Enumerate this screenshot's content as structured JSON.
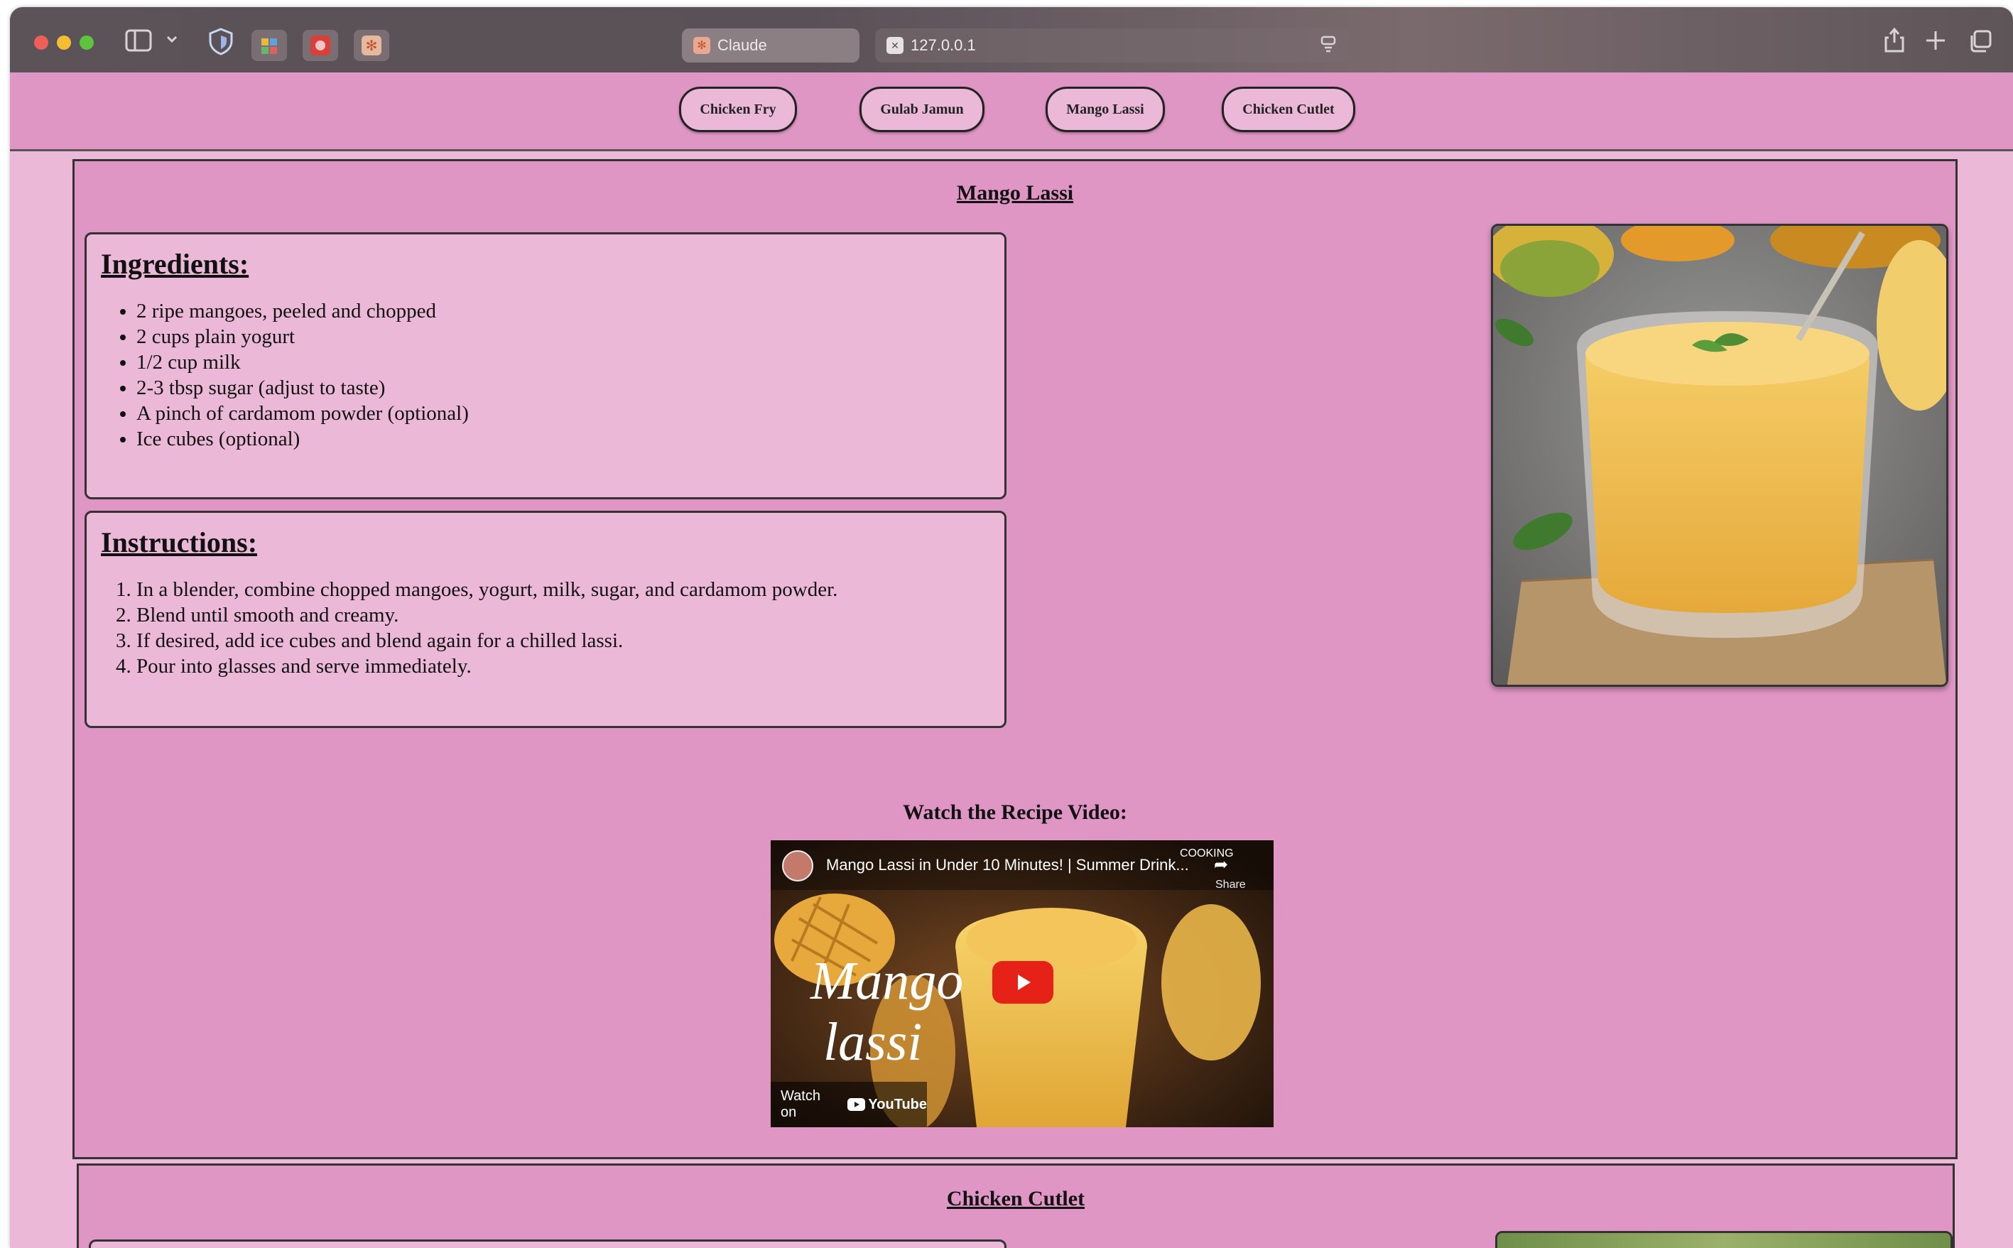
{
  "browser": {
    "tabs": [
      {
        "label": "Claude",
        "active": true
      },
      {
        "label": "127.0.0.1",
        "active": false
      }
    ],
    "icons": [
      "sidebar-icon",
      "chevron-down-icon",
      "shield-icon",
      "share-icon",
      "plus-icon",
      "tabs-overview-icon"
    ]
  },
  "nav": {
    "buttons": [
      "Chicken Fry",
      "Gulab Jamun",
      "Mango Lassi",
      "Chicken Cutlet"
    ]
  },
  "recipe": {
    "title": "Mango Lassi",
    "ingredients_heading": "Ingredients:",
    "ingredients": [
      "2 ripe mangoes, peeled and chopped",
      "2 cups plain yogurt",
      "1/2 cup milk",
      "2-3 tbsp sugar (adjust to taste)",
      "A pinch of cardamom powder (optional)",
      "Ice cubes (optional)"
    ],
    "instructions_heading": "Instructions:",
    "instructions": [
      "In a blender, combine chopped mangoes, yogurt, milk, sugar, and cardamom powder.",
      "Blend until smooth and creamy.",
      "If desired, add ice cubes and blend again for a chilled lassi.",
      "Pour into glasses and serve immediately."
    ],
    "video_heading": "Watch the Recipe Video:",
    "video": {
      "title": "Mango Lassi in Under 10 Minutes! | Summer Drink...",
      "overlay_line1": "Mango",
      "overlay_line2": "lassi",
      "share_label": "Share",
      "watch_on": "Watch on",
      "platform": "YouTube",
      "channel_badge": "COOKING"
    }
  },
  "next_recipe": {
    "title": "Chicken Cutlet"
  },
  "colors": {
    "page_bg": "#ebb8d8",
    "card_bg": "#e096c4",
    "box_bg": "#ebb8d8",
    "border": "#333333"
  }
}
